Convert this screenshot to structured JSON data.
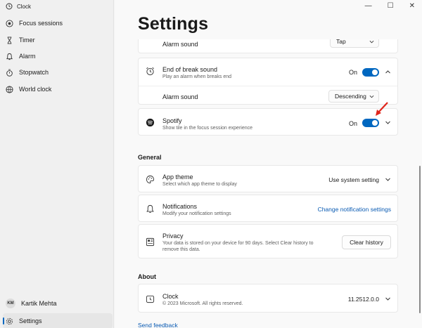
{
  "app": {
    "title": "Clock",
    "window_minimize": "—",
    "window_maximize": "☐",
    "window_close": "✕"
  },
  "sidebar": {
    "items": [
      {
        "label": "Focus sessions",
        "icon": "focus-icon"
      },
      {
        "label": "Timer",
        "icon": "hourglass-icon"
      },
      {
        "label": "Alarm",
        "icon": "bell-icon"
      },
      {
        "label": "Stopwatch",
        "icon": "stopwatch-icon"
      },
      {
        "label": "World clock",
        "icon": "globe-icon"
      }
    ],
    "user": {
      "initials": "KM",
      "name": "Kartik Mehta"
    },
    "settings_label": "Settings"
  },
  "main": {
    "title": "Settings",
    "alarm_sound_top": {
      "label": "Alarm sound",
      "value": "Tap"
    },
    "end_break": {
      "title": "End of break sound",
      "desc": "Play an alarm when breaks end",
      "state": "On",
      "alarm_sound_label": "Alarm sound",
      "alarm_sound_value": "Descending"
    },
    "spotify": {
      "title": "Spotify",
      "desc": "Show tile in the focus session experience",
      "state": "On"
    },
    "general_heading": "General",
    "app_theme": {
      "title": "App theme",
      "desc": "Select which app theme to display",
      "value": "Use system setting"
    },
    "notifications": {
      "title": "Notifications",
      "desc": "Modify your notification settings",
      "link": "Change notification settings"
    },
    "privacy": {
      "title": "Privacy",
      "desc_line1": "Your data is stored on your device for 90 days. Select Clear history to",
      "desc_line2": "remove this data.",
      "button": "Clear history"
    },
    "about_heading": "About",
    "about": {
      "title": "Clock",
      "desc": "© 2023 Microsoft. All rights reserved.",
      "version": "11.2512.0.0"
    },
    "send_feedback": "Send feedback"
  },
  "colors": {
    "accent": "#0067c0",
    "arrow": "#e0251b"
  }
}
